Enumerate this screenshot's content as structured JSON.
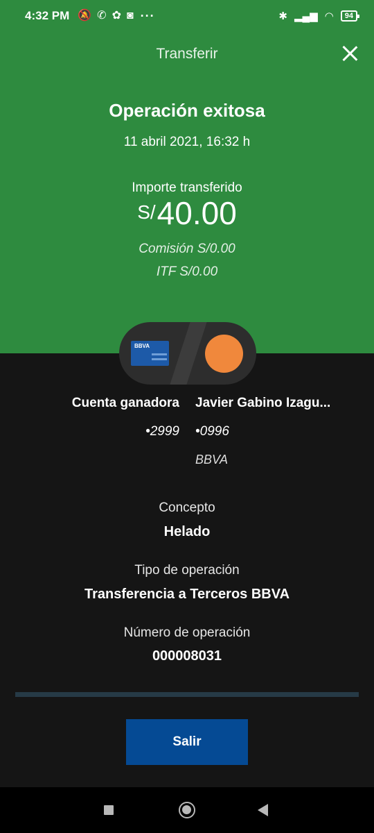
{
  "status_bar": {
    "time": "4:32 PM",
    "dots": "···",
    "battery": "94",
    "icons": [
      "muted-bell-icon",
      "whatsapp-icon",
      "app-icon",
      "app-icon",
      "bluetooth-icon",
      "signal-icon",
      "wifi-icon",
      "battery-icon"
    ]
  },
  "header": {
    "title": "Transferir"
  },
  "result": {
    "title": "Operación exitosa",
    "datetime": "11 abril 2021, 16:32 h",
    "amount_label": "Importe transferido",
    "currency": "S/",
    "amount": "40.00",
    "commission": "Comisión  S/0.00",
    "itf": "ITF  S/0.00"
  },
  "accounts": {
    "origin_name": "Cuenta ganadora",
    "origin_number": "•2999",
    "dest_name": "Javier Gabino Izagu...",
    "dest_number": "•0996",
    "dest_bank": "BBVA",
    "card_brand": "BBVA"
  },
  "details": {
    "concept_label": "Concepto",
    "concept_value": "Helado",
    "type_label": "Tipo de operación",
    "type_value": "Transferencia a Terceros BBVA",
    "number_label": "Número de operación",
    "number_value": "000008031"
  },
  "actions": {
    "exit_label": "Salir"
  },
  "colors": {
    "success_green": "#2e8b3f",
    "background": "#151515",
    "primary_button": "#054a94",
    "accent_orange": "#f0883c"
  }
}
